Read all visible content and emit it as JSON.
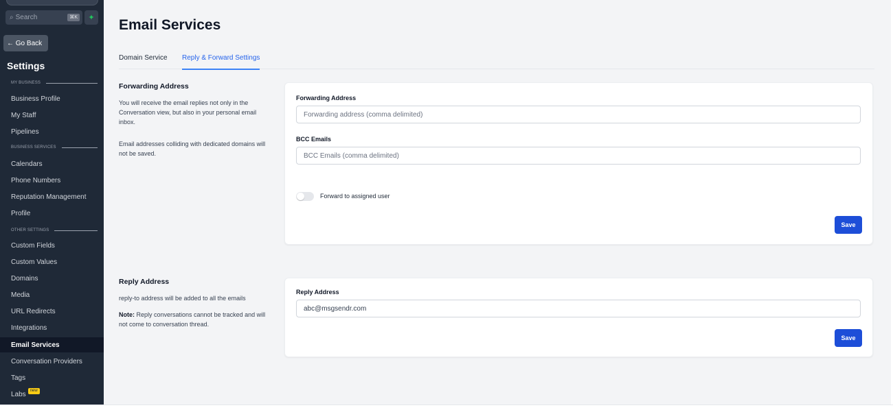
{
  "sidebar": {
    "search_placeholder": "Search",
    "search_shortcut": "⌘K",
    "go_back_label": "← Go Back",
    "title": "Settings",
    "sections": {
      "my_business": "MY BUSINESS",
      "business_services": "BUSINESS SERVICES",
      "other_settings": "OTHER SETTINGS"
    },
    "items": [
      {
        "label": "Business Profile"
      },
      {
        "label": "My Staff"
      },
      {
        "label": "Pipelines"
      },
      {
        "label": "Calendars"
      },
      {
        "label": "Phone Numbers"
      },
      {
        "label": "Reputation Management"
      },
      {
        "label": "Profile"
      },
      {
        "label": "Custom Fields"
      },
      {
        "label": "Custom Values"
      },
      {
        "label": "Domains"
      },
      {
        "label": "Media"
      },
      {
        "label": "URL Redirects"
      },
      {
        "label": "Integrations"
      },
      {
        "label": "Email Services",
        "active": true
      },
      {
        "label": "Conversation Providers"
      },
      {
        "label": "Tags"
      },
      {
        "label": "Labs",
        "badge": "new"
      }
    ]
  },
  "main": {
    "title": "Email Services",
    "tabs": [
      {
        "label": "Domain Service"
      },
      {
        "label": "Reply & Forward Settings",
        "active": true
      }
    ],
    "forwarding": {
      "title": "Forwarding Address",
      "desc1": "You will receive the email replies not only in the Conversation view, but also in your personal email inbox.",
      "desc2": "Email addresses colliding with dedicated domains will not be saved.",
      "field1_label": "Forwarding Address",
      "field1_placeholder": "Forwarding address (comma delimited)",
      "field2_label": "BCC Emails",
      "field2_placeholder": "BCC Emails (comma delimited)",
      "toggle_label": "Forward to assigned user",
      "toggle_on": false,
      "save_label": "Save"
    },
    "reply": {
      "title": "Reply Address",
      "desc1": "reply-to address will be added to all the emails",
      "note_label": "Note:",
      "note_text": " Reply conversations cannot be tracked and will not come to conversation thread.",
      "field_label": "Reply Address",
      "field_value": "abc@msgsendr.com",
      "save_label": "Save"
    }
  },
  "colors": {
    "sidebar_bg": "#1f2937",
    "main_bg": "#f3f4f6",
    "accent": "#2563eb",
    "save_button": "#1d4ed8"
  }
}
